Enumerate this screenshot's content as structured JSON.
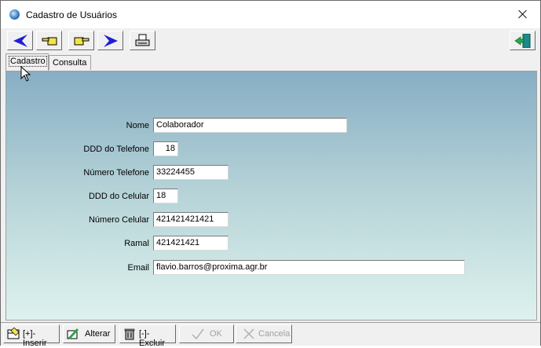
{
  "window": {
    "title": "Cadastro de Usuários"
  },
  "toolbar": {
    "buttons": [
      "first-icon",
      "previous-icon",
      "next-icon",
      "last-icon",
      "print-icon",
      "exit-icon"
    ]
  },
  "tabs": [
    {
      "label": "Cadastro",
      "active": true
    },
    {
      "label": "Consulta",
      "active": false
    }
  ],
  "form": {
    "nome": {
      "label": "Nome",
      "value": "Colaborador"
    },
    "ddd_telefone": {
      "label": "DDD do Telefone",
      "value": "18"
    },
    "numero_telefone": {
      "label": "Número Telefone",
      "value": "33224455"
    },
    "ddd_celular": {
      "label": "DDD do Celular",
      "value": "18"
    },
    "numero_celular": {
      "label": "Número Celular",
      "value": "421421421421"
    },
    "ramal": {
      "label": "Ramal",
      "value": "421421421"
    },
    "email": {
      "label": "Email",
      "value": "flavio.barros@proxima.agr.br"
    }
  },
  "actions": {
    "inserir": "[+]-Inserir",
    "alterar": "Alterar",
    "excluir": "[-]-Excluir",
    "ok": "OK",
    "cancela": "Cancela"
  },
  "colors": {
    "panel_top": "#87aec4",
    "panel_bottom": "#def2ee",
    "nav_arrow": "#1f1fd1",
    "hand_yellow": "#f2e34a"
  }
}
